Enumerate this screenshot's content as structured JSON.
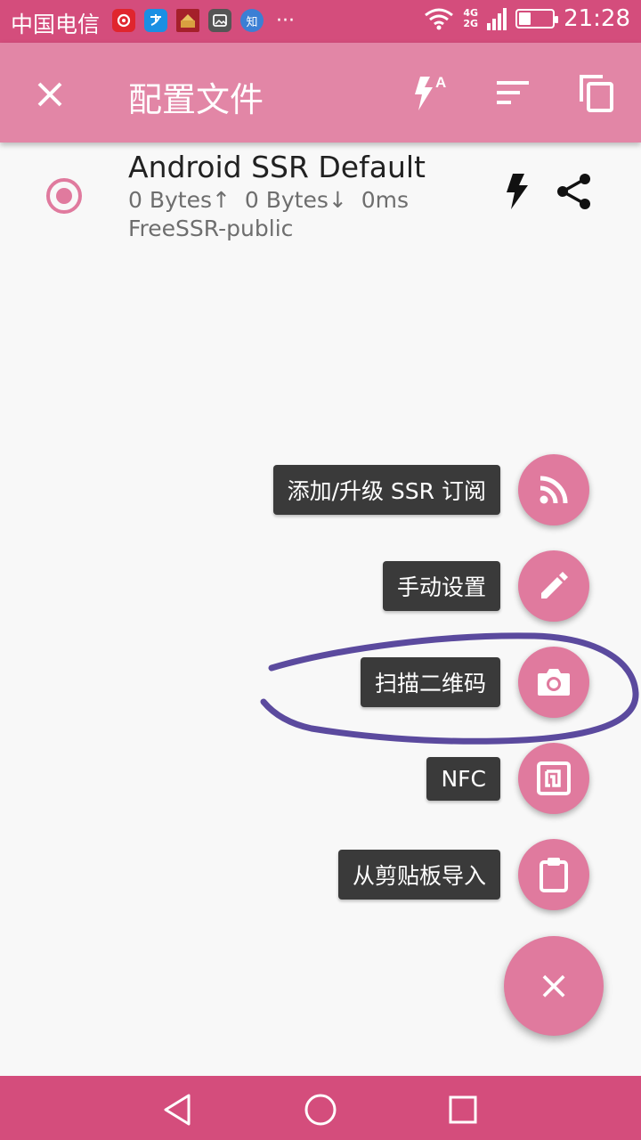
{
  "status_bar": {
    "carrier": "中国电信",
    "app_icons": [
      "netease-music-icon",
      "alipay-icon",
      "game-icon",
      "gallery-icon",
      "zhihu-icon"
    ],
    "zhihu_glyph": "知",
    "more": "···",
    "network_4g": "4G",
    "network_2g": "2G",
    "battery_level": 0.35,
    "time": "21:28"
  },
  "app_bar": {
    "title": "配置文件",
    "actions": [
      "close-icon",
      "auto-connect-icon",
      "sort-icon",
      "copy-icon"
    ],
    "auto_badge": "A"
  },
  "profile": {
    "name": "Android SSR Default",
    "stats": "0 Bytes↑  0 Bytes↓  0ms",
    "group": "FreeSSR-public",
    "selected": true
  },
  "fab_menu": {
    "items": [
      {
        "label": "添加/升级 SSR 订阅",
        "icon": "rss-icon"
      },
      {
        "label": "手动设置",
        "icon": "pencil-icon"
      },
      {
        "label": "扫描二维码",
        "icon": "camera-icon"
      },
      {
        "label": "NFC",
        "icon": "nfc-icon"
      },
      {
        "label": "从剪贴板导入",
        "icon": "clipboard-icon"
      }
    ],
    "close_glyph": "×"
  },
  "colors": {
    "status_bar": "#d44d7c",
    "app_bar": "#e286a6",
    "accent": "#e07a9e",
    "annotation": "#5b4a9e",
    "label_bg": "#3a3a3a"
  }
}
